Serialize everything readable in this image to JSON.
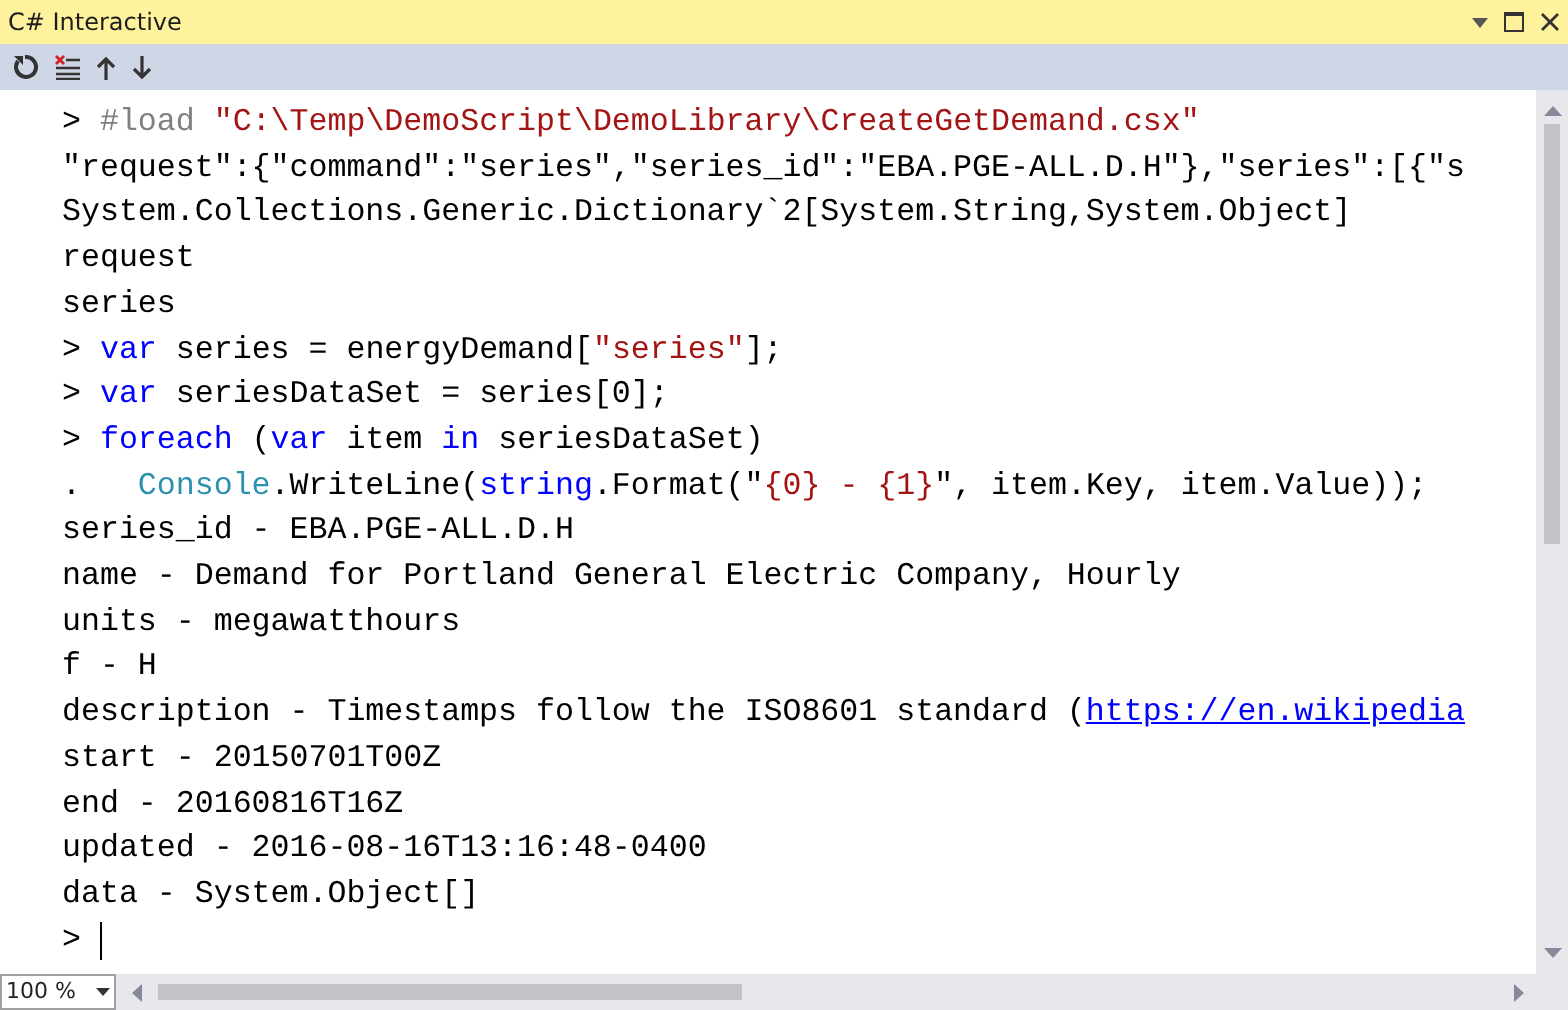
{
  "window": {
    "title": "C# Interactive"
  },
  "lines": [
    {
      "segments": [
        {
          "kind": "plain",
          "text": "> "
        },
        {
          "kind": "directive",
          "text": "#load "
        },
        {
          "kind": "string",
          "text": "\"C:\\Temp\\DemoScript\\DemoLibrary\\CreateGetDemand.csx\""
        }
      ]
    },
    {
      "segments": [
        {
          "kind": "plain",
          "text": "\"request\":{\"command\":\"series\",\"series_id\":\"EBA.PGE-ALL.D.H\"},\"series\":[{\"s"
        }
      ]
    },
    {
      "segments": [
        {
          "kind": "plain",
          "text": "System.Collections.Generic.Dictionary`2[System.String,System.Object]"
        }
      ]
    },
    {
      "segments": [
        {
          "kind": "plain",
          "text": "request"
        }
      ]
    },
    {
      "segments": [
        {
          "kind": "plain",
          "text": "series"
        }
      ]
    },
    {
      "segments": [
        {
          "kind": "plain",
          "text": "> "
        },
        {
          "kind": "keyword",
          "text": "var"
        },
        {
          "kind": "plain",
          "text": " series = energyDemand["
        },
        {
          "kind": "string",
          "text": "\"series\""
        },
        {
          "kind": "plain",
          "text": "];"
        }
      ]
    },
    {
      "segments": [
        {
          "kind": "plain",
          "text": "> "
        },
        {
          "kind": "keyword",
          "text": "var"
        },
        {
          "kind": "plain",
          "text": " seriesDataSet = series[0];"
        }
      ]
    },
    {
      "segments": [
        {
          "kind": "plain",
          "text": "> "
        },
        {
          "kind": "keyword",
          "text": "foreach"
        },
        {
          "kind": "plain",
          "text": " ("
        },
        {
          "kind": "keyword",
          "text": "var"
        },
        {
          "kind": "plain",
          "text": " item "
        },
        {
          "kind": "keyword",
          "text": "in"
        },
        {
          "kind": "plain",
          "text": " seriesDataSet)"
        }
      ]
    },
    {
      "segments": [
        {
          "kind": "plain",
          "text": ".   "
        },
        {
          "kind": "type",
          "text": "Console"
        },
        {
          "kind": "plain",
          "text": ".WriteLine("
        },
        {
          "kind": "keyword",
          "text": "string"
        },
        {
          "kind": "plain",
          "text": ".Format(\""
        },
        {
          "kind": "string",
          "text": "{0} - {1}"
        },
        {
          "kind": "plain",
          "text": "\", item.Key, item.Value));"
        }
      ]
    },
    {
      "segments": [
        {
          "kind": "plain",
          "text": "series_id - EBA.PGE-ALL.D.H"
        }
      ]
    },
    {
      "segments": [
        {
          "kind": "plain",
          "text": "name - Demand for Portland General Electric Company, Hourly"
        }
      ]
    },
    {
      "segments": [
        {
          "kind": "plain",
          "text": "units - megawatthours"
        }
      ]
    },
    {
      "segments": [
        {
          "kind": "plain",
          "text": "f - H"
        }
      ]
    },
    {
      "segments": [
        {
          "kind": "plain",
          "text": "description - Timestamps follow the ISO8601 standard ("
        },
        {
          "kind": "link",
          "text": "https://en.wikipedia"
        }
      ]
    },
    {
      "segments": [
        {
          "kind": "plain",
          "text": "start - 20150701T00Z"
        }
      ]
    },
    {
      "segments": [
        {
          "kind": "plain",
          "text": "end - 20160816T16Z"
        }
      ]
    },
    {
      "segments": [
        {
          "kind": "plain",
          "text": "updated - 2016-08-16T13:16:48-0400"
        }
      ]
    },
    {
      "segments": [
        {
          "kind": "plain",
          "text": "data - System.Object[]"
        }
      ]
    }
  ],
  "prompt": {
    "text": "> ",
    "cursor": true
  },
  "zoom": {
    "value": "100 %"
  }
}
